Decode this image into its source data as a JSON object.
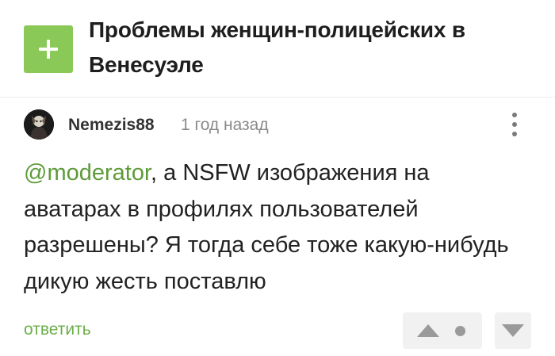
{
  "story": {
    "title": "Проблемы женщин-полицейских в Венесуэле",
    "add_icon": "plus-icon"
  },
  "comment": {
    "author": "Nemezis88",
    "time": "1 год назад",
    "mention": "@moderator",
    "text": ", а NSFW изображения на аватарах в профилях пользователей разрешены? Я тогда себе тоже какую-нибудь дикую жесть поставлю",
    "more_icon": "vertical-dots-icon"
  },
  "actions": {
    "reply_label": "ответить",
    "upvote_icon": "triangle-up-icon",
    "rating_icon": "dot-icon",
    "downvote_icon": "triangle-down-icon"
  },
  "colors": {
    "accent_green": "#8ac858",
    "link_green": "#6cae4a",
    "muted_gray": "#8a8a8a"
  }
}
